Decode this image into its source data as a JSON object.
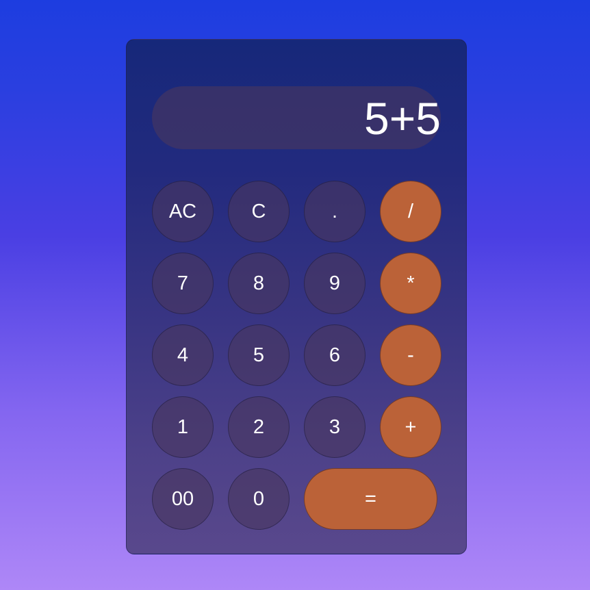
{
  "display": {
    "value": "5+5"
  },
  "keys": {
    "ac": "AC",
    "c": "C",
    "dot": ".",
    "divide": "/",
    "seven": "7",
    "eight": "8",
    "nine": "9",
    "multiply": "*",
    "four": "4",
    "five": "5",
    "six": "6",
    "minus": "-",
    "one": "1",
    "two": "2",
    "three": "3",
    "plus": "+",
    "double_zero": "00",
    "zero": "0",
    "equals": "="
  },
  "colors": {
    "operator": "#bb6238",
    "key": "#48375f",
    "text": "#ffffff"
  }
}
